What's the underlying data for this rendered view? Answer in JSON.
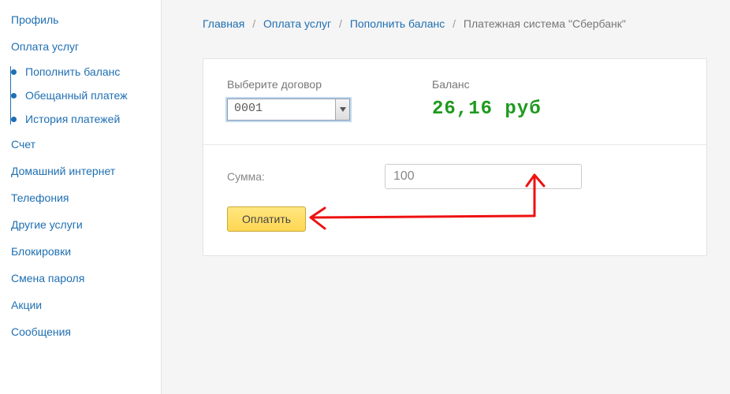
{
  "sidebar": {
    "items": [
      {
        "label": "Профиль"
      },
      {
        "label": "Оплата услуг",
        "children": [
          {
            "label": "Пополнить баланс"
          },
          {
            "label": "Обещанный платеж"
          },
          {
            "label": "История платежей"
          }
        ]
      },
      {
        "label": "Счет"
      },
      {
        "label": "Домашний интернет"
      },
      {
        "label": "Телефония"
      },
      {
        "label": "Другие услуги"
      },
      {
        "label": "Блокировки"
      },
      {
        "label": "Смена пароля"
      },
      {
        "label": "Акции"
      },
      {
        "label": "Сообщения"
      }
    ]
  },
  "breadcrumb": {
    "items": [
      {
        "label": "Главная"
      },
      {
        "label": "Оплата услуг"
      },
      {
        "label": "Пополнить баланс"
      }
    ],
    "current": "Платежная система \"Сбербанк\""
  },
  "form": {
    "contract_label": "Выберите договор",
    "contract_value": "0001",
    "balance_label": "Баланс",
    "balance_value": "26,16  руб",
    "sum_label": "Сумма:",
    "sum_value": "100",
    "pay_label": "Оплатить"
  }
}
